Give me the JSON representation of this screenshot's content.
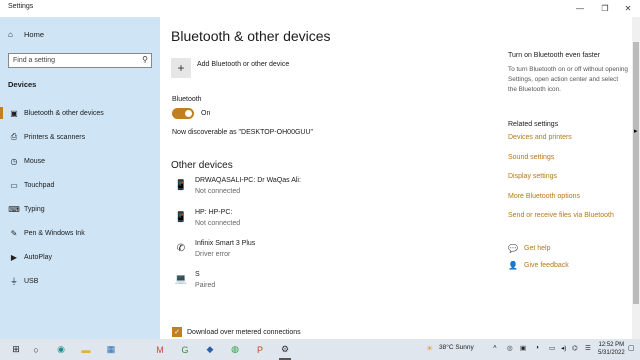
{
  "window": {
    "title": "Settings",
    "controls": [
      "—",
      "❐",
      "✕"
    ]
  },
  "sidebar": {
    "home": "Home",
    "search_placeholder": "Find a setting",
    "section": "Devices",
    "items": [
      {
        "label": "Bluetooth & other devices",
        "icon": "bluetooth-devices-icon",
        "glyph": "▣",
        "selected": true
      },
      {
        "label": "Printers & scanners",
        "icon": "printer-icon",
        "glyph": "⎙"
      },
      {
        "label": "Mouse",
        "icon": "mouse-icon",
        "glyph": "◷"
      },
      {
        "label": "Touchpad",
        "icon": "touchpad-icon",
        "glyph": "▭"
      },
      {
        "label": "Typing",
        "icon": "keyboard-icon",
        "glyph": "⌨"
      },
      {
        "label": "Pen & Windows Ink",
        "icon": "pen-icon",
        "glyph": "✎"
      },
      {
        "label": "AutoPlay",
        "icon": "autoplay-icon",
        "glyph": "▶"
      },
      {
        "label": "USB",
        "icon": "usb-icon",
        "glyph": "⏚"
      }
    ]
  },
  "main": {
    "title": "Bluetooth & other devices",
    "add_device": "Add Bluetooth or other device",
    "bluetooth_label": "Bluetooth",
    "bluetooth_state": "On",
    "discoverable": "Now discoverable as \"DESKTOP-OH00GUU\"",
    "other_devices_title": "Other devices",
    "devices": [
      {
        "name": "DRWAQASALI-PC: Dr WaQas Ali:",
        "status": "Not connected",
        "icon": "phone-icon",
        "glyph": "📱"
      },
      {
        "name": "HP: HP-PC:",
        "status": "Not connected",
        "icon": "phone-icon",
        "glyph": "📱"
      },
      {
        "name": "Infinix Smart 3 Plus",
        "status": "Driver error",
        "icon": "phone-handset-icon",
        "glyph": "✆"
      },
      {
        "name": "S",
        "status": "Paired",
        "icon": "laptop-icon",
        "glyph": "💻"
      }
    ],
    "metered": "Download over metered connections"
  },
  "right_column": {
    "turn_on_title": "Turn on Bluetooth even faster",
    "turn_on_desc": "To turn Bluetooth on or off without opening Settings, open action center and select the Bluetooth icon.",
    "related_title": "Related settings",
    "related_links": [
      "Devices and printers",
      "Sound settings",
      "Display settings",
      "More Bluetooth options",
      "Send or receive files via Bluetooth"
    ],
    "get_help": "Get help",
    "give_feedback": "Give feedback"
  },
  "taskbar": {
    "weather": "38°C  Sunny",
    "time": "12:52 PM",
    "date": "5/31/2022",
    "apps": [
      {
        "name": "start-button",
        "glyph": "⊞",
        "color": "#1a1a1a"
      },
      {
        "name": "search-button",
        "glyph": "○",
        "color": "#1a1a1a"
      },
      {
        "name": "edge-icon",
        "glyph": "◉",
        "color": "#1f8f8a"
      },
      {
        "name": "file-explorer-icon",
        "glyph": "▬",
        "color": "#e0b236"
      },
      {
        "name": "store-icon",
        "glyph": "▦",
        "color": "#2a6fb5"
      },
      {
        "name": "mail-icon",
        "glyph": "M",
        "color": "#d44638"
      },
      {
        "name": "chrome-icon",
        "glyph": "G",
        "color": "#3c8d3c"
      },
      {
        "name": "app-icon",
        "glyph": "◆",
        "color": "#2b5fa6"
      },
      {
        "name": "whatsapp-icon",
        "glyph": "◍",
        "color": "#25a244"
      },
      {
        "name": "powerpoint-icon",
        "glyph": "P",
        "color": "#c8482b"
      },
      {
        "name": "settings-icon",
        "glyph": "⚙",
        "color": "#333333"
      }
    ]
  },
  "colors": {
    "accent": "#c0801f",
    "sidebar_bg": "#cfe5f6",
    "link": "#b5771a"
  }
}
